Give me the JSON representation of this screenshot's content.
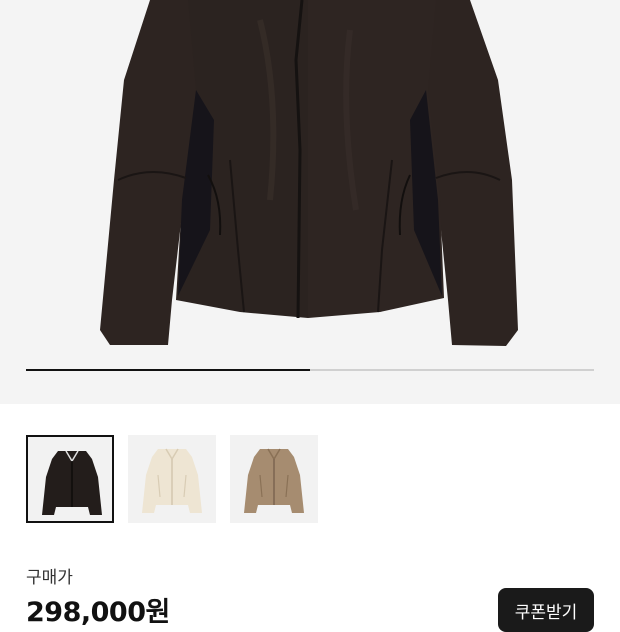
{
  "gallery": {
    "main_image": "black-jacket-product-photo",
    "progress": 0.5,
    "thumbnails": [
      {
        "name": "black-jacket-thumbnail",
        "color": "#2b2624",
        "selected": true
      },
      {
        "name": "cream-jacket-thumbnail",
        "color": "#efe7d6",
        "selected": false
      },
      {
        "name": "khaki-jacket-thumbnail",
        "color": "#a88f72",
        "selected": false
      }
    ]
  },
  "pricing": {
    "label": "구매가",
    "price": "298,000원"
  },
  "actions": {
    "coupon_label": "쿠폰받기"
  }
}
